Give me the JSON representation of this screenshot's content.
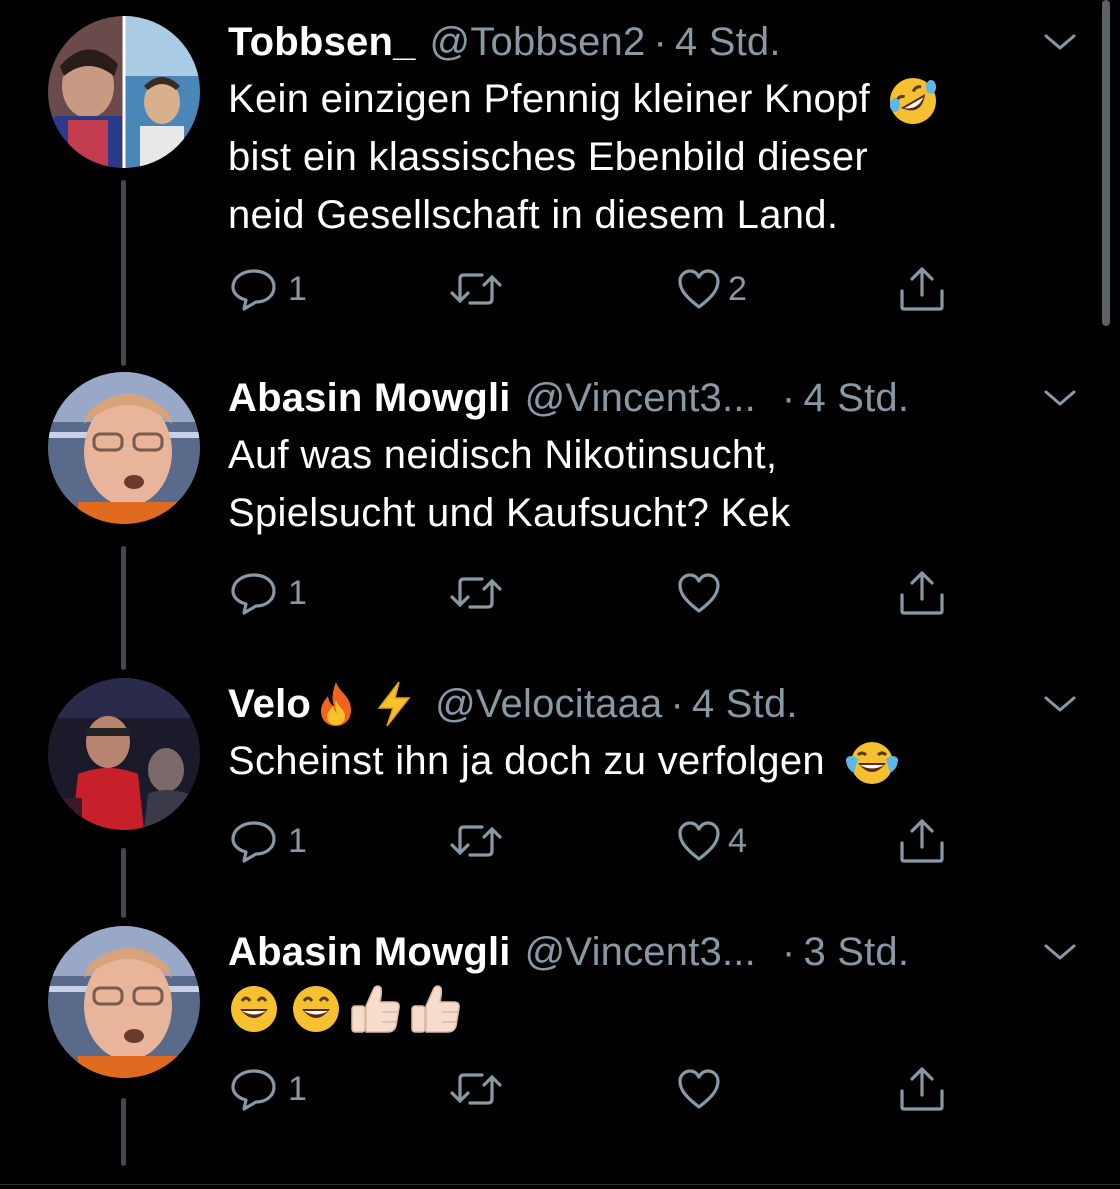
{
  "tweets": [
    {
      "name": "Tobbsen_",
      "handle": "@Tobbsen2",
      "time": "4 Std.",
      "lines": [
        "Kein einzigen Pfennig kleiner Knopf",
        "bist ein klassisches Ebenbild dieser",
        "neid Gesellschaft in diesem Land."
      ],
      "reply_count": "1",
      "retweet_count": "",
      "like_count": "2"
    },
    {
      "name": "Abasin Mowgli",
      "handle": "@Vincent3...",
      "time": "4 Std.",
      "lines": [
        "Auf was neidisch Nikotinsucht,",
        "Spielsucht und Kaufsucht? Kek"
      ],
      "reply_count": "1",
      "retweet_count": "",
      "like_count": ""
    },
    {
      "name": "Velo",
      "handle": "@Velocitaaa",
      "time": "4 Std.",
      "lines": [
        "Scheinst ihn ja doch zu verfolgen"
      ],
      "reply_count": "1",
      "retweet_count": "",
      "like_count": "4"
    },
    {
      "name": "Abasin Mowgli",
      "handle": "@Vincent3...",
      "time": "3 Std.",
      "lines": [],
      "reply_count": "1",
      "retweet_count": "",
      "like_count": ""
    }
  ],
  "separator": "·",
  "icons": {
    "reply": "reply-bubble-icon",
    "retweet": "retweet-arrows-icon",
    "like": "heart-icon",
    "share": "share-upload-icon",
    "more": "chevron-down-icon",
    "emoji_rofl": "rolling-on-floor-laughing-emoji",
    "emoji_fire": "fire-emoji",
    "emoji_lightning": "high-voltage-emoji",
    "emoji_joy": "face-with-tears-of-joy-emoji",
    "emoji_grin": "grinning-face-emoji",
    "emoji_thumbs": "thumbs-up-light-skin-emoji"
  },
  "colors": {
    "background": "#000000",
    "primary_text": "#ffffff",
    "secondary_text": "#8899a6",
    "thread_line": "#42484f"
  }
}
